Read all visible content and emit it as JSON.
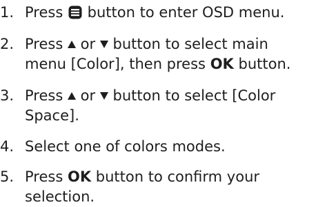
{
  "steps": [
    {
      "number": "1.",
      "press": "Press",
      "icon": "menu-icon",
      "text": "button to enter OSD menu."
    },
    {
      "number": "2.",
      "press": "Press",
      "or": "or",
      "text1": "button to select main",
      "text2_a": "menu [Color], then press",
      "ok": "OK",
      "text2_b": "button."
    },
    {
      "number": "3.",
      "press": "Press",
      "or": "or",
      "text1": "button to select [Color",
      "text2": "Space]."
    },
    {
      "number": "4.",
      "text": "Select one of colors modes."
    },
    {
      "number": "5.",
      "press": "Press",
      "ok": "OK",
      "text1": "button to confirm your",
      "text2": "selection."
    }
  ],
  "icons": {
    "up": "up-triangle-icon",
    "down": "down-triangle-icon"
  },
  "colors": {
    "text": "#1e1e1e",
    "background": "#ffffff"
  }
}
